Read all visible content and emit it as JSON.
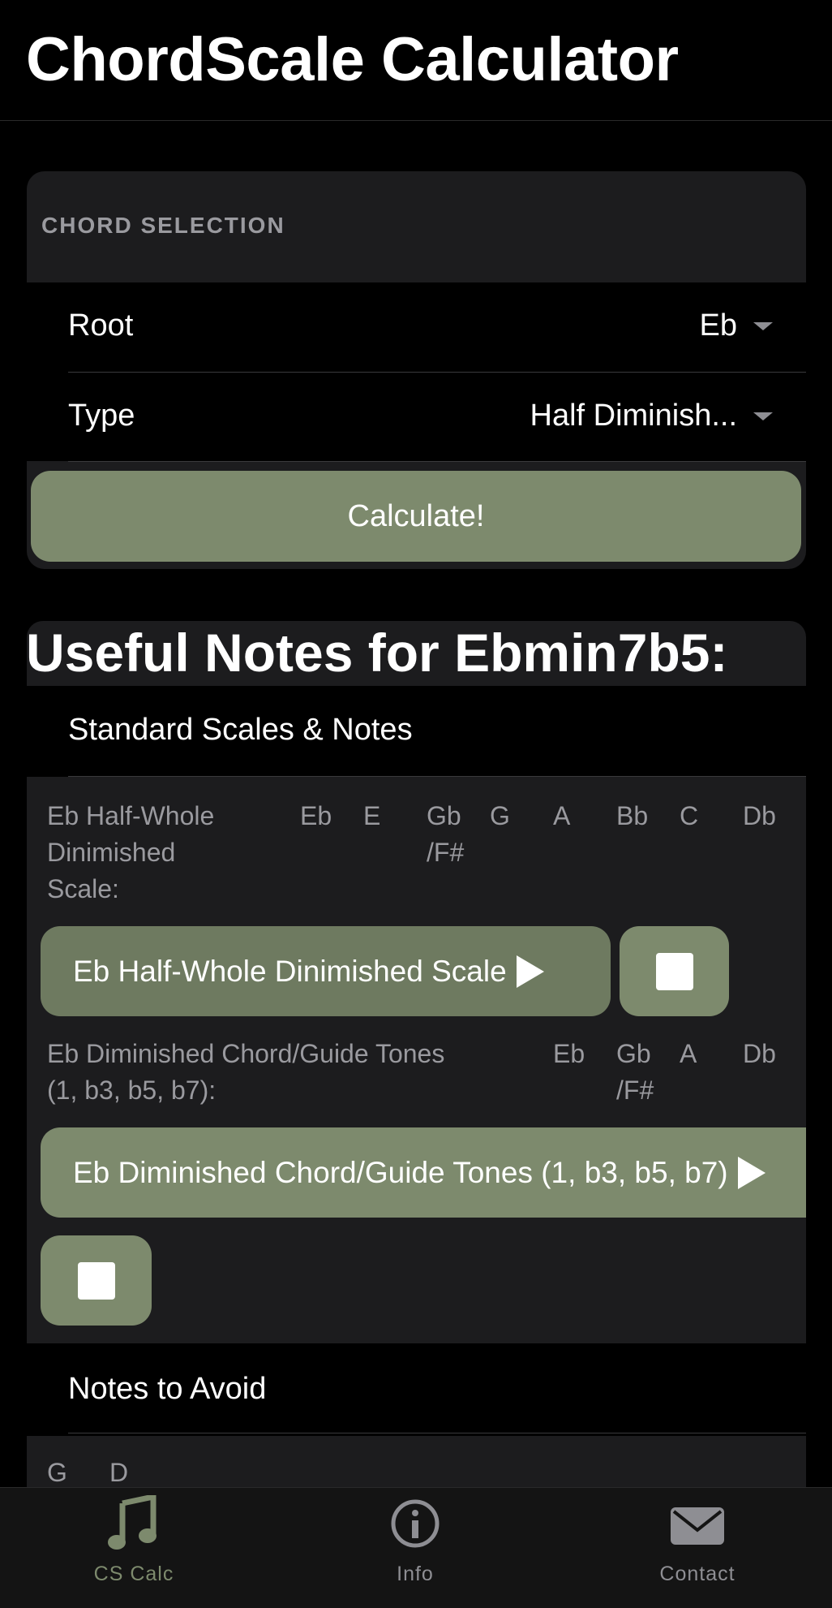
{
  "app_title": "ChordScale Calculator",
  "chord_selection": {
    "header": "CHORD SELECTION",
    "root_label": "Root",
    "root_value": "Eb",
    "type_label": "Type",
    "type_value": "Half Diminish...",
    "calculate_label": "Calculate!"
  },
  "results": {
    "title": "Useful Notes for Ebmin7b5:",
    "standard_section_label": "Standard Scales & Notes",
    "scale1": {
      "label_line1": "Eb Half-Whole",
      "label_line2": "Dinimished",
      "label_line3": "Scale:",
      "notes": [
        "Eb",
        "E",
        "Gb",
        "G",
        "A",
        "Bb",
        "C",
        "Db"
      ],
      "alt_note": "/F#",
      "play_label": "Eb Half-Whole Dinimished Scale"
    },
    "scale2": {
      "label_line1": "Eb Diminished Chord/Guide Tones",
      "label_line2": "(1, b3, b5, b7):",
      "notes": [
        "Eb",
        "Gb",
        "A",
        "Db"
      ],
      "alt_note": "/F#",
      "play_label": "Eb Diminished Chord/Guide Tones (1, b3, b5, b7)"
    },
    "avoid_section_label": "Notes to Avoid",
    "avoid_notes": [
      "G",
      "D"
    ]
  },
  "tabbar": {
    "tabs": [
      {
        "label": "CS Calc",
        "icon": "music-note-icon",
        "active": true
      },
      {
        "label": "Info",
        "icon": "info-icon",
        "active": false
      },
      {
        "label": "Contact",
        "icon": "envelope-icon",
        "active": false
      }
    ],
    "active_color": "#7d8a6d",
    "inactive_color": "#8e8e93"
  },
  "colors": {
    "accent": "#7d8a6d",
    "accent_dark": "#6e7a60",
    "panel": "#1c1c1e",
    "background": "#000000"
  }
}
